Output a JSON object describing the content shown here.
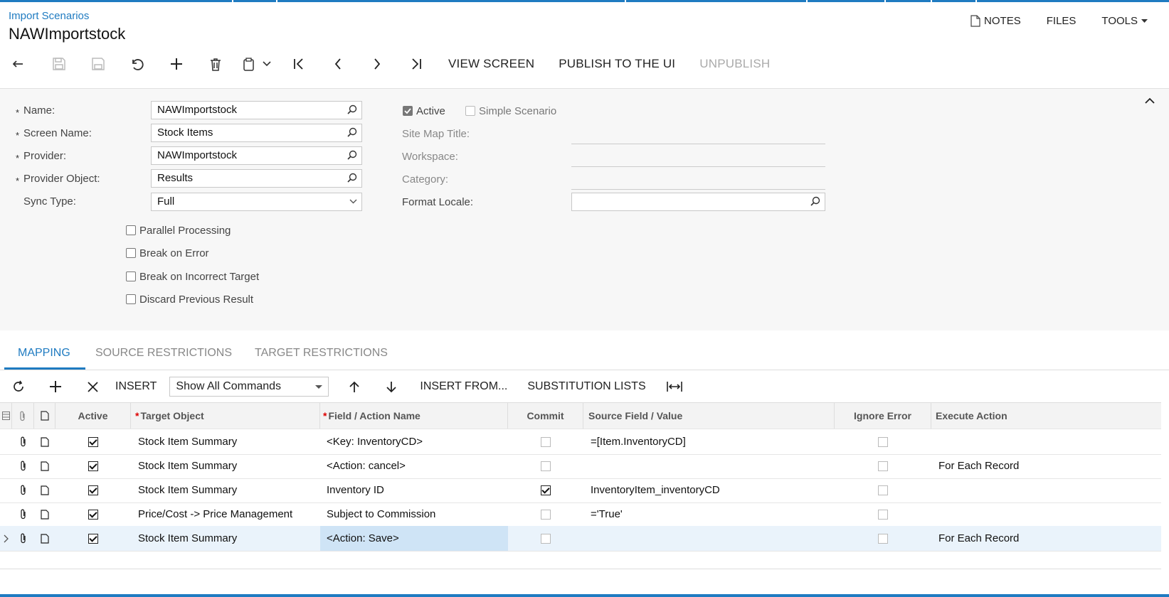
{
  "header": {
    "breadcrumb": "Import Scenarios",
    "title": "NAWImportstock",
    "menu": {
      "notes": "NOTES",
      "files": "FILES",
      "tools": "TOOLS"
    }
  },
  "toolbar": {
    "view_screen": "VIEW SCREEN",
    "publish": "PUBLISH TO THE UI",
    "unpublish": "UNPUBLISH"
  },
  "form": {
    "name_label": "Name:",
    "name_value": "NAWImportstock",
    "screen_label": "Screen Name:",
    "screen_value": "Stock Items",
    "provider_label": "Provider:",
    "provider_value": "NAWImportstock",
    "provider_object_label": "Provider Object:",
    "provider_object_value": "Results",
    "sync_label": "Sync Type:",
    "sync_value": "Full",
    "required_mark": "*",
    "active_label": "Active",
    "simple_label": "Simple Scenario",
    "sitemap_label": "Site Map Title:",
    "workspace_label": "Workspace:",
    "category_label": "Category:",
    "locale_label": "Format Locale:",
    "parallel_label": "Parallel Processing",
    "break_error_label": "Break on Error",
    "break_target_label": "Break on Incorrect Target",
    "discard_label": "Discard Previous Result"
  },
  "tabs": [
    "MAPPING",
    "SOURCE RESTRICTIONS",
    "TARGET RESTRICTIONS"
  ],
  "grid_toolbar": {
    "insert": "INSERT",
    "command_filter": "Show All Commands",
    "insert_from": "INSERT FROM...",
    "substitution": "SUBSTITUTION LISTS"
  },
  "grid": {
    "columns": {
      "active": "Active",
      "target": "Target Object",
      "field": "Field / Action Name",
      "commit": "Commit",
      "source": "Source Field / Value",
      "ignore": "Ignore Error",
      "execute": "Execute Action"
    },
    "rows": [
      {
        "target": "Stock Item Summary",
        "field": "<Key: InventoryCD>",
        "source": "=[Item.InventoryCD]",
        "execute": ""
      },
      {
        "target": "Stock Item Summary",
        "field": "<Action: cancel>",
        "source": "",
        "execute": "For Each Record"
      },
      {
        "target": "Stock Item Summary",
        "field": "Inventory ID",
        "source": "InventoryItem_inventoryCD",
        "execute": ""
      },
      {
        "target": "Price/Cost -> Price Management",
        "field": "Subject to Commission",
        "source": "='True'",
        "execute": ""
      },
      {
        "target": "Stock Item Summary",
        "field": "<Action: Save>",
        "source": "",
        "execute": "For Each Record"
      }
    ]
  },
  "colors": {
    "accent": "#1f7bc1"
  }
}
